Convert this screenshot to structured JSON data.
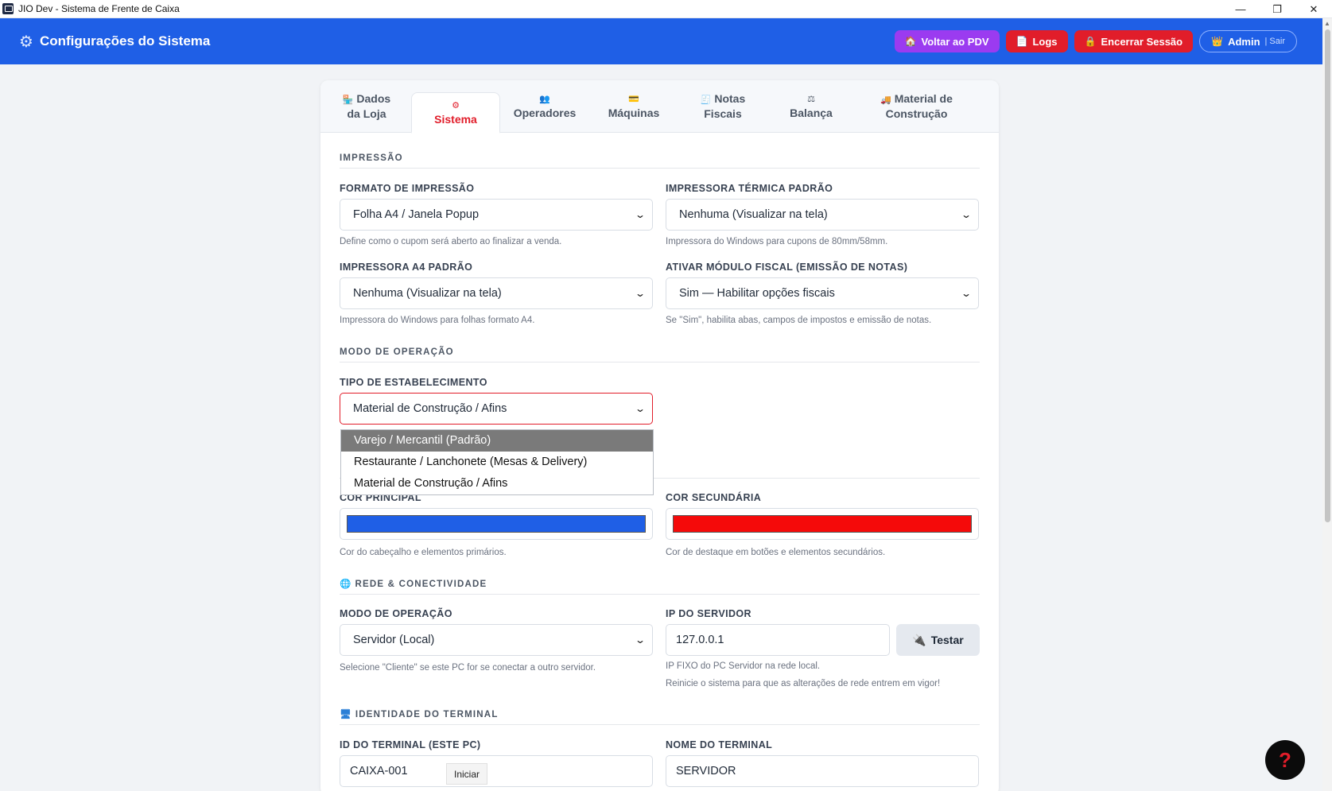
{
  "window": {
    "title": "JIO Dev - Sistema de Frente de Caixa",
    "minimize": "—",
    "restore": "❐",
    "close": "✕"
  },
  "header": {
    "title": "Configurações do Sistema",
    "buttons": {
      "pdv": "Voltar ao PDV",
      "logs": "Logs",
      "end_session": "Encerrar Sessão",
      "admin": "Admin",
      "logout": "| Sair"
    }
  },
  "tabs": [
    {
      "label1": "Dados",
      "label2": "da Loja"
    },
    {
      "label1": "Sistema",
      "label2": ""
    },
    {
      "label1": "Operadores",
      "label2": ""
    },
    {
      "label1": "Máquinas",
      "label2": ""
    },
    {
      "label1": "Notas",
      "label2": "Fiscais"
    },
    {
      "label1": "Balança",
      "label2": ""
    },
    {
      "label1": "Material de",
      "label2": "Construção"
    }
  ],
  "sections": {
    "impressao": "IMPRESSÃO",
    "modo": "MODO DE OPERAÇÃO",
    "rede": "REDE & CONECTIVIDADE",
    "terminal": "IDENTIDADE DO TERMINAL"
  },
  "fields": {
    "formato": {
      "label": "FORMATO DE IMPRESSÃO",
      "value": "Folha A4 / Janela Popup",
      "hint": "Define como o cupom será aberto ao finalizar a venda."
    },
    "termica": {
      "label": "IMPRESSORA TÉRMICA PADRÃO",
      "value": "Nenhuma (Visualizar na tela)",
      "hint": "Impressora do Windows para cupons de 80mm/58mm."
    },
    "a4": {
      "label": "IMPRESSORA A4 PADRÃO",
      "value": "Nenhuma (Visualizar na tela)",
      "hint": "Impressora do Windows para folhas formato A4."
    },
    "fiscal": {
      "label": "ATIVAR MÓDULO FISCAL (EMISSÃO DE NOTAS)",
      "value": "Sim — Habilitar opções fiscais",
      "hint": "Se \"Sim\", habilita abas, campos de impostos e emissão de notas."
    },
    "tipo": {
      "label": "TIPO DE ESTABELECIMENTO",
      "value": "Material de Construção / Afins"
    },
    "cor_principal": {
      "label": "COR PRINCIPAL",
      "color": "#1f5fe6",
      "hint": "Cor do cabeçalho e elementos primários."
    },
    "cor_secundaria": {
      "label": "COR SECUNDÁRIA",
      "color": "#f50a0a",
      "hint": "Cor de destaque em botões e elementos secundários."
    },
    "modo_rede": {
      "label": "MODO DE OPERAÇÃO",
      "value": "Servidor (Local)",
      "hint": "Selecione \"Cliente\" se este PC for se conectar a outro servidor."
    },
    "ip": {
      "label": "IP DO SERVIDOR",
      "value": "127.0.0.1",
      "hint": "IP FIXO do PC Servidor na rede local.",
      "hint2": "Reinicie o sistema para que as alterações de rede entrem em vigor!",
      "test": "Testar"
    },
    "terminal_id": {
      "label": "ID DO TERMINAL (ESTE PC)",
      "value": "CAIXA-001"
    },
    "terminal_nome": {
      "label": "NOME DO TERMINAL",
      "value": "SERVIDOR"
    }
  },
  "dropdown_options": [
    "Varejo / Mercantil (Padrão)",
    "Restaurante / Lanchonete (Mesas & Delivery)",
    "Material de Construção / Afins"
  ],
  "tooltip": "Iniciar",
  "help": "?"
}
